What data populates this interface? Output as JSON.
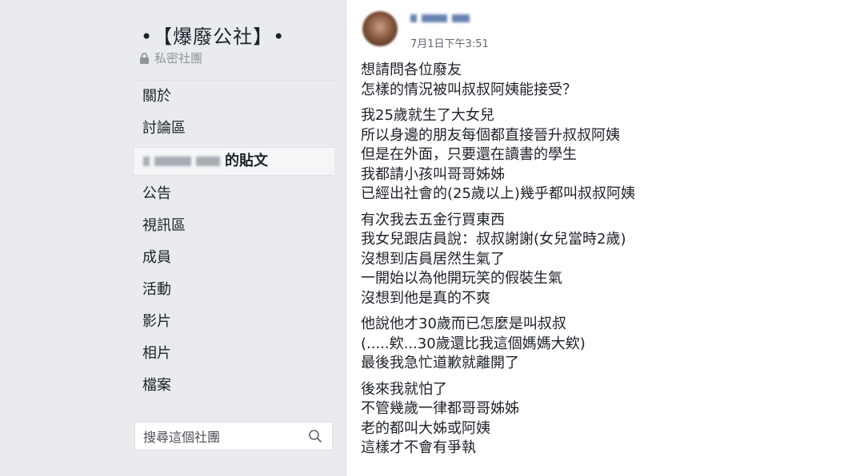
{
  "group": {
    "title": "•【爆廢公社】•",
    "privacy": "私密社團"
  },
  "nav": {
    "items": [
      {
        "label": "關於"
      },
      {
        "label": "討論區"
      },
      {
        "label": "的貼文",
        "active": true
      },
      {
        "label": "公告"
      },
      {
        "label": "視訊區"
      },
      {
        "label": "成員"
      },
      {
        "label": "活動"
      },
      {
        "label": "影片"
      },
      {
        "label": "相片"
      },
      {
        "label": "檔案"
      }
    ]
  },
  "search": {
    "placeholder": "搜尋這個社團"
  },
  "post": {
    "timestamp": "7月1日下午3:51",
    "paragraphs": [
      [
        "想請問各位廢友",
        "怎樣的情況被叫叔叔阿姨能接受？"
      ],
      [
        "我25歲就生了大女兒",
        "所以身邊的朋友每個都直接晉升叔叔阿姨",
        "但是在外面，只要還在讀書的學生",
        "我都請小孩叫哥哥姊姊",
        "已經出社會的(25歲以上)幾乎都叫叔叔阿姨"
      ],
      [
        "有次我去五金行買東西",
        "我女兒跟店員說：叔叔謝謝(女兒當時2歲)",
        "沒想到店員居然生氣了",
        "一開始以為他開玩笑的假裝生氣",
        "沒想到他是真的不爽"
      ],
      [
        "他說他才30歲而已怎麼是叫叔叔",
        "(.....欸...30歲還比我這個媽媽大欸)",
        "最後我急忙道歉就離開了"
      ],
      [
        "後來我就怕了",
        "不管幾歲一律都哥哥姊姊",
        "老的都叫大姊或阿姨",
        "這樣才不會有爭執"
      ]
    ]
  },
  "colors": {
    "background": "#e9ebee",
    "text": "#1d2129",
    "muted": "#90949c",
    "link": "#365899"
  }
}
